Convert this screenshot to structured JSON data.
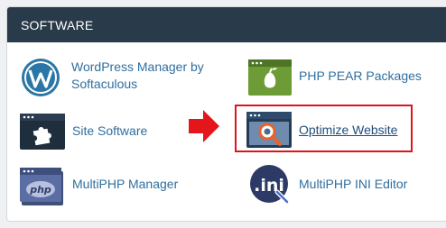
{
  "panel": {
    "header": "SOFTWARE"
  },
  "items": [
    {
      "label_line1": "WordPress Manager by",
      "label_line2": "Softaculous",
      "icon": "wordpress-icon"
    },
    {
      "label": "PHP PEAR Packages",
      "icon": "pear-icon"
    },
    {
      "label": "Site Software",
      "icon": "puzzle-icon"
    },
    {
      "label": "Optimize Website",
      "icon": "optimize-magnifier-icon"
    },
    {
      "label": "MultiPHP Manager",
      "icon": "php-icon"
    },
    {
      "label": "MultiPHP INI Editor",
      "icon": "ini-icon"
    }
  ],
  "colors": {
    "header_bg": "#293a4a",
    "link": "#2f6f9e",
    "highlight": "#d9161d"
  }
}
